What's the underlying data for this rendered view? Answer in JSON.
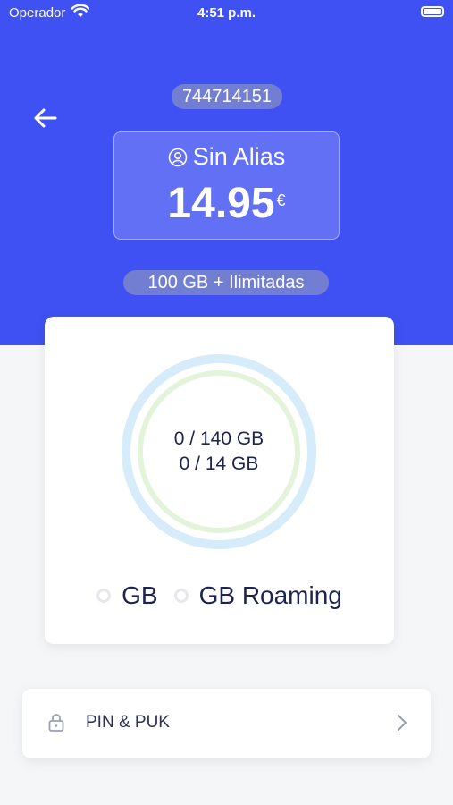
{
  "status_bar": {
    "carrier": "Operador",
    "time": "4:51 p.m."
  },
  "header": {
    "phone_number": "744714151",
    "alias_label": "Sin Alias",
    "amount": "14.95",
    "currency": "€",
    "plan": "100 GB + Ilimitadas"
  },
  "usage": {
    "data_line": "0 / 140 GB",
    "roaming_line": "0 / 14 GB",
    "data_fraction": 0,
    "roaming_fraction": 0,
    "legend": [
      {
        "label": "GB"
      },
      {
        "label": "GB Roaming"
      }
    ]
  },
  "pin_row": {
    "label": "PIN & PUK"
  },
  "colors": {
    "brand_blue": "#3f51f2",
    "ring_outer": "#d6ecfb",
    "ring_inner": "#e3f4da",
    "text_dark": "#1d2350"
  }
}
